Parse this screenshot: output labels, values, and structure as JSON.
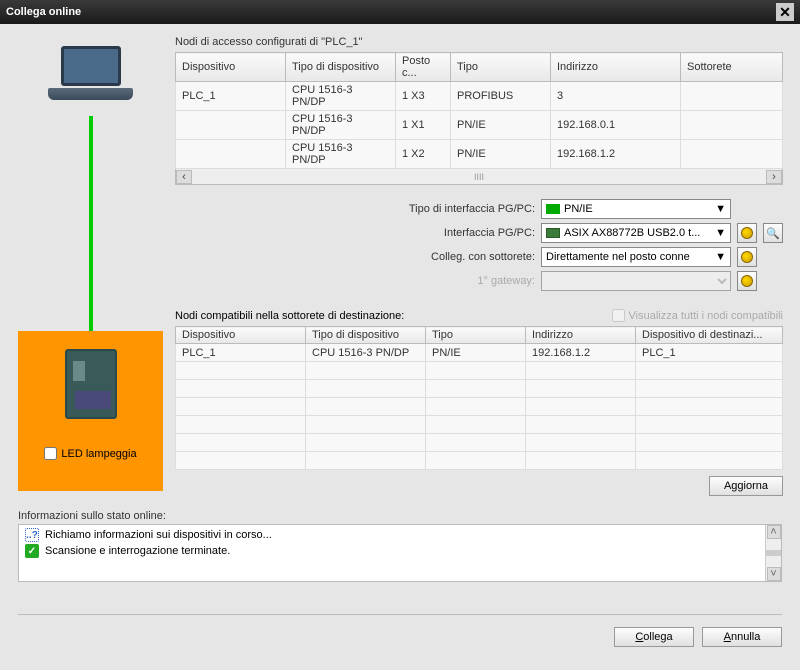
{
  "title": "Collega online",
  "config_nodes_label": "Nodi di accesso configurati di \"PLC_1\"",
  "table1": {
    "headers": [
      "Dispositivo",
      "Tipo di dispositivo",
      "Posto c...",
      "Tipo",
      "Indirizzo",
      "Sottorete"
    ],
    "rows": [
      [
        "PLC_1",
        "CPU 1516-3 PN/DP",
        "1 X3",
        "PROFIBUS",
        "3",
        ""
      ],
      [
        "",
        "CPU 1516-3 PN/DP",
        "1 X1",
        "PN/IE",
        "192.168.0.1",
        ""
      ],
      [
        "",
        "CPU 1516-3 PN/DP",
        "1 X2",
        "PN/IE",
        "192.168.1.2",
        ""
      ]
    ]
  },
  "form": {
    "if_type_label": "Tipo di interfaccia PG/PC:",
    "if_type_value": "PN/IE",
    "if_label": "Interfaccia PG/PC:",
    "if_value": "ASIX AX88772B USB2.0 t...",
    "subnet_label": "Colleg. con sottorete:",
    "subnet_value": "Direttamente nel posto conne",
    "gateway_label": "1° gateway:",
    "gateway_value": ""
  },
  "compat_label": "Nodi compatibili nella sottorete di destinazione:",
  "show_all_label": "Visualizza tutti i nodi compatibili",
  "table2": {
    "headers": [
      "Dispositivo",
      "Tipo di dispositivo",
      "Tipo",
      "Indirizzo",
      "Dispositivo di destinazi..."
    ],
    "rows": [
      [
        "PLC_1",
        "CPU 1516-3 PN/DP",
        "PN/IE",
        "192.168.1.2",
        "PLC_1"
      ]
    ]
  },
  "led_label": "LED lampeggia",
  "refresh_btn": "Aggiorna",
  "status_label": "Informazioni sullo stato online:",
  "status_lines": [
    {
      "icon": "loading",
      "text": "Richiamo informazioni sui dispositivi in corso..."
    },
    {
      "icon": "ok",
      "text": "Scansione e interrogazione terminate."
    }
  ],
  "connect_btn": "Collega",
  "cancel_btn": "Annulla"
}
